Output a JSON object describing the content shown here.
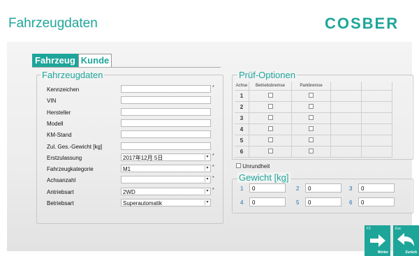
{
  "header": {
    "title": "Fahrzeugdaten",
    "logo_text": "COSBER"
  },
  "tabs": [
    {
      "label": "Fahrzeug"
    },
    {
      "label": "Kunde"
    }
  ],
  "vehicle": {
    "legend": "Fahrzeugdaten",
    "fields": [
      {
        "label": "Kennzeichen",
        "value": "",
        "required": "*"
      },
      {
        "label": "VIN",
        "value": "",
        "required": ""
      },
      {
        "label": "Hersteller",
        "value": "",
        "required": ""
      },
      {
        "label": "Modell",
        "value": "",
        "required": ""
      },
      {
        "label": "KM-Stand",
        "value": "",
        "required": ""
      },
      {
        "label": "Zul. Ges.-Gewicht [kg]",
        "value": "",
        "required": ""
      },
      {
        "label": "Erstzulassung",
        "value": "2017年12月 5日",
        "required": "*"
      },
      {
        "label": "Fahrzeugkategorie",
        "value": "M1",
        "required": "*"
      },
      {
        "label": "Achsanzahl",
        "value": "",
        "required": "*"
      },
      {
        "label": "Antriebsart",
        "value": "2WD",
        "required": "*"
      },
      {
        "label": "Betriebsart",
        "value": "Superautomatik",
        "required": ""
      }
    ]
  },
  "pruef": {
    "legend": "Prüf-Optionen",
    "columns": [
      "Achse",
      "Betriebsbremse",
      "Parkbremse",
      "",
      ""
    ],
    "rows": [
      "1",
      "2",
      "3",
      "4",
      "5",
      "6"
    ]
  },
  "unrundheit": {
    "label": "Unrundheit"
  },
  "gewicht": {
    "legend": "Gewicht [kg]",
    "items": [
      {
        "num": "1",
        "value": "0"
      },
      {
        "num": "2",
        "value": "0"
      },
      {
        "num": "3",
        "value": "0"
      },
      {
        "num": "4",
        "value": "0"
      },
      {
        "num": "5",
        "value": "0"
      },
      {
        "num": "6",
        "value": "0"
      }
    ]
  },
  "nav": {
    "weiter": {
      "key": "F2",
      "label": "Weiter"
    },
    "zurueck": {
      "key": "Esc",
      "label": "Zurück"
    }
  },
  "colors": {
    "accent": "#1ea59a"
  }
}
